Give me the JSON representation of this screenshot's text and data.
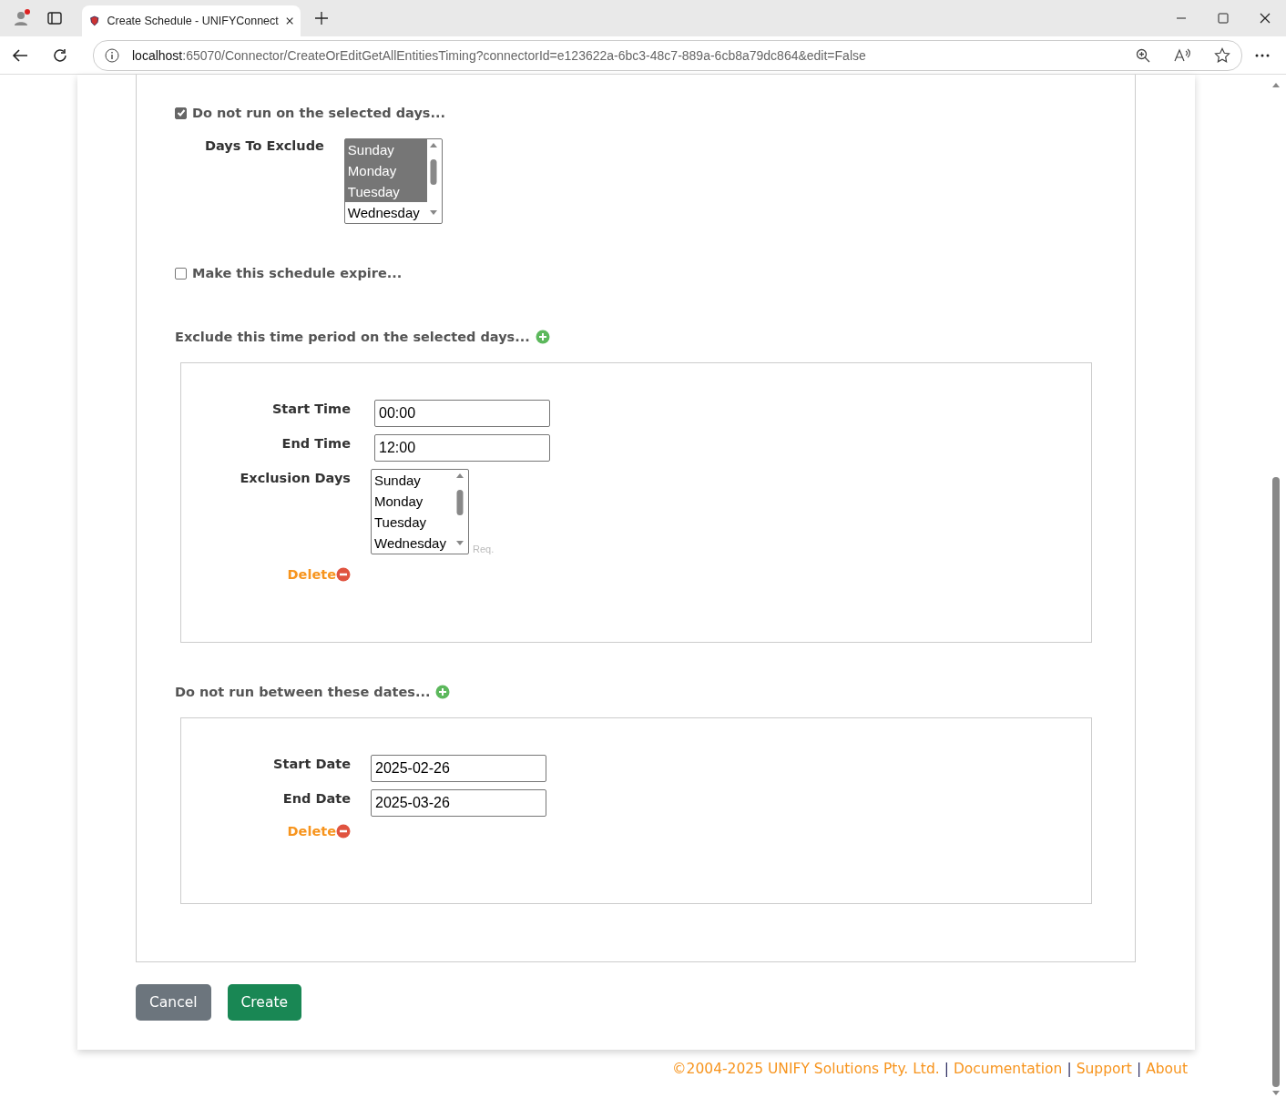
{
  "browser": {
    "tab_title": "Create Schedule - UNIFYConnect",
    "url_host": "localhost",
    "url_rest": ":65070/Connector/CreateOrEditGetAllEntitiesTiming?connectorId=e123622a-6bc3-48c7-889a-6cb8a79dc864&edit=False"
  },
  "exclude_days": {
    "label": "Do not run on the selected days...",
    "checked": true
  },
  "days_to_exclude": {
    "label": "Days To Exclude",
    "options": [
      {
        "label": "Sunday",
        "selected": true
      },
      {
        "label": "Monday",
        "selected": true
      },
      {
        "label": "Tuesday",
        "selected": true
      },
      {
        "label": "Wednesday",
        "selected": false
      }
    ]
  },
  "expire": {
    "label": "Make this schedule expire...",
    "checked": false
  },
  "time_section": {
    "heading": "Exclude this time period on the selected days...",
    "entries": [
      {
        "start_label": "Start Time",
        "start_value": "00:00",
        "end_label": "End Time",
        "end_value": "12:00",
        "days_label": "Exclusion Days",
        "days": [
          {
            "label": "Sunday",
            "selected": false
          },
          {
            "label": "Monday",
            "selected": false
          },
          {
            "label": "Tuesday",
            "selected": false
          },
          {
            "label": "Wednesday",
            "selected": false
          }
        ],
        "hint": "Req.",
        "delete": "Delete"
      }
    ]
  },
  "date_section": {
    "heading": "Do not run between these dates...",
    "entries": [
      {
        "start_label": "Start Date",
        "start_value": "2025-02-26",
        "end_label": "End Date",
        "end_value": "2025-03-26",
        "delete": "Delete"
      }
    ]
  },
  "buttons": [
    {
      "label": "Cancel",
      "kind": "secondary"
    },
    {
      "label": "Create",
      "kind": "primary"
    }
  ],
  "footer": [
    {
      "kind": "text",
      "text": "©2004-2025 UNIFY Solutions Pty. Ltd."
    },
    {
      "kind": "separator",
      "text": "|"
    },
    {
      "kind": "link",
      "text": "Documentation"
    },
    {
      "kind": "separator",
      "text": "|"
    },
    {
      "kind": "link",
      "text": "Support"
    },
    {
      "kind": "separator",
      "text": "|"
    },
    {
      "kind": "link",
      "text": "About"
    }
  ]
}
